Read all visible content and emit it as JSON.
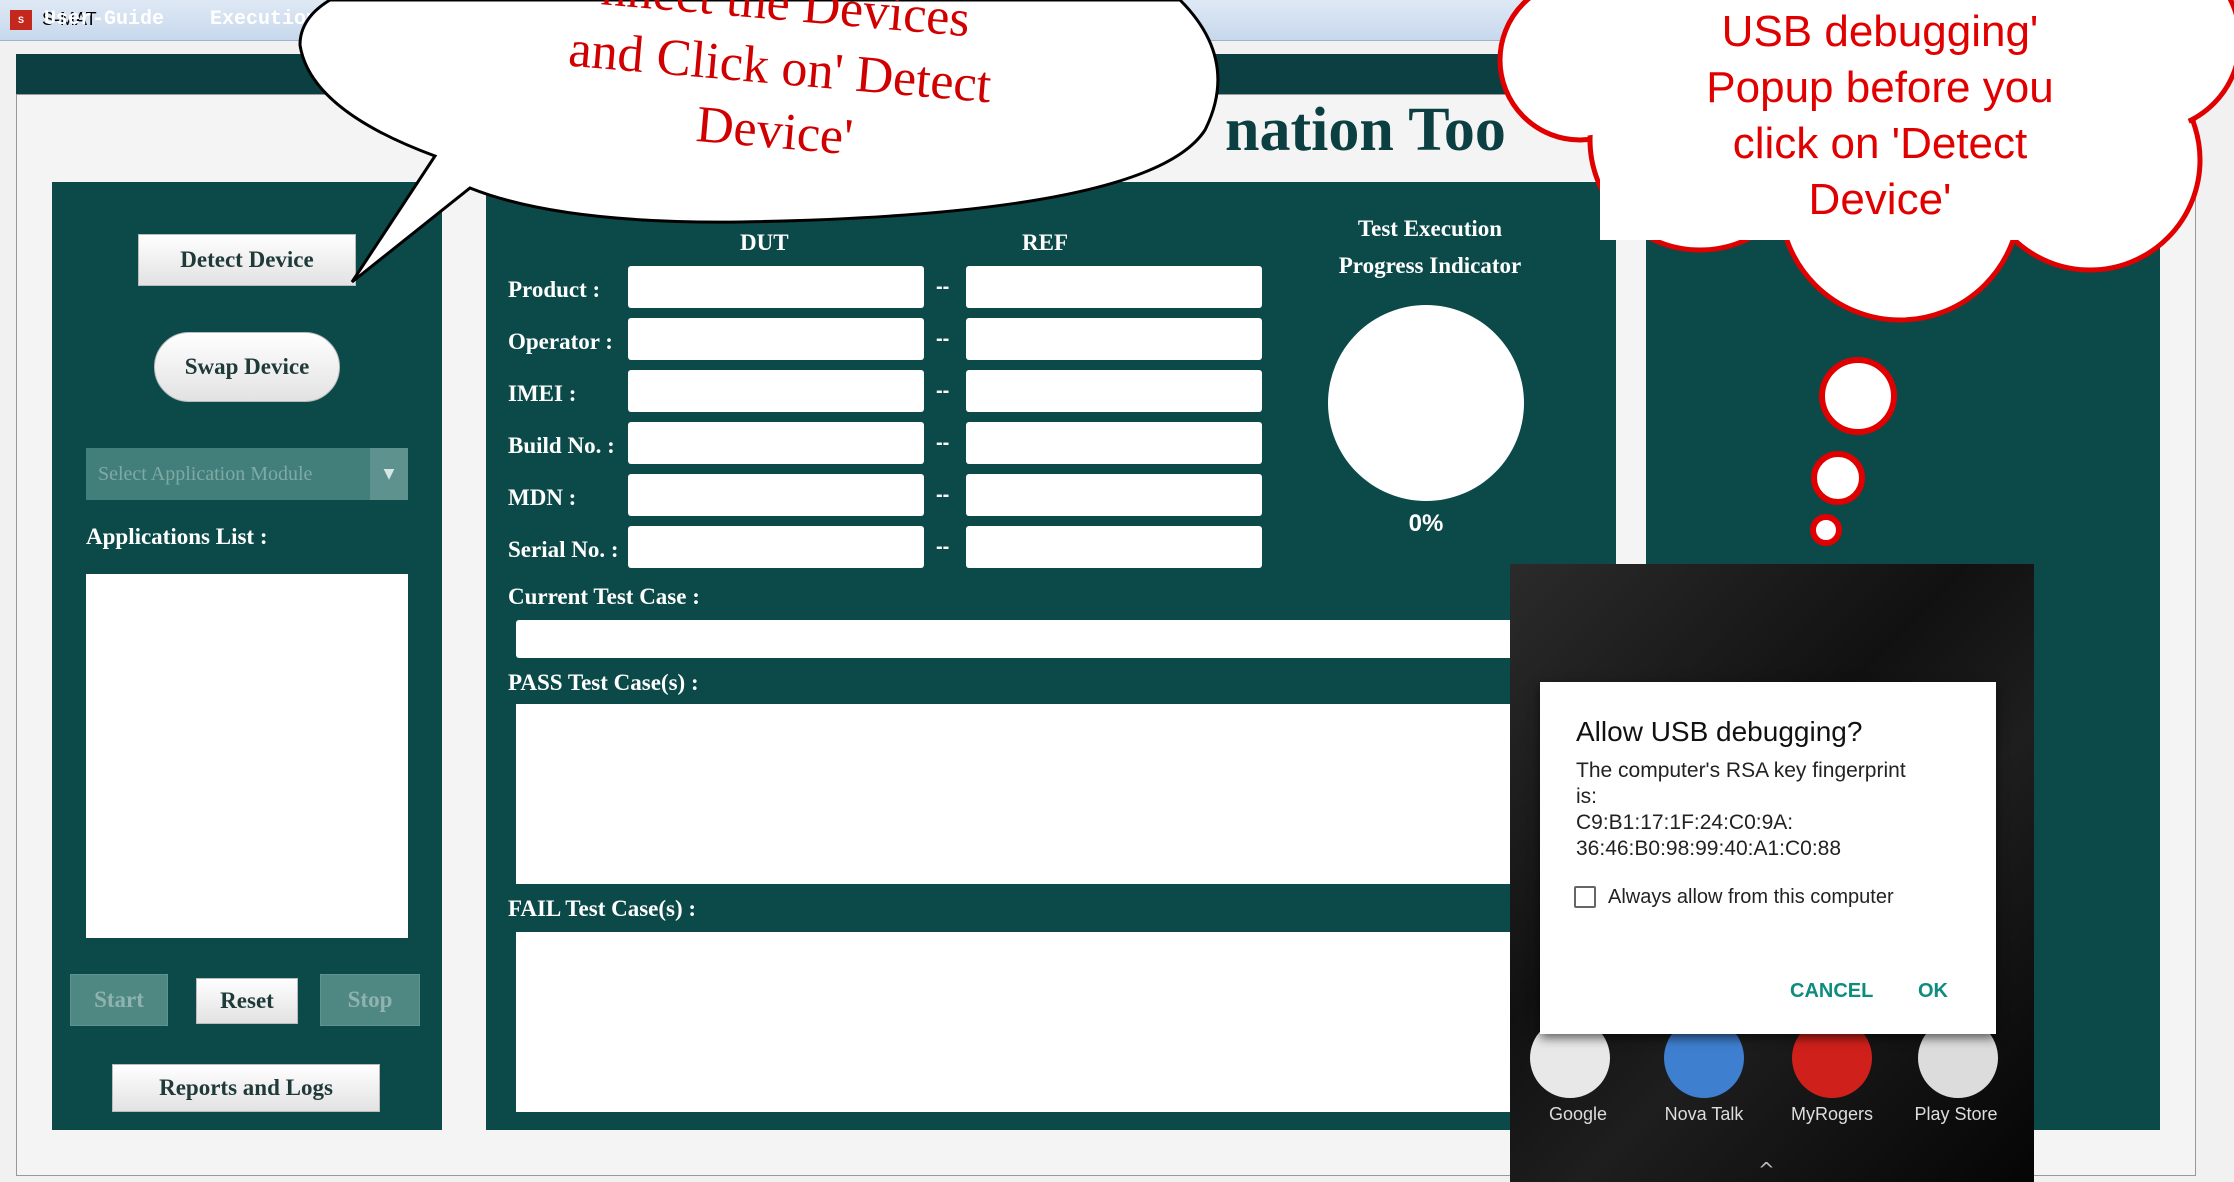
{
  "window": {
    "title": "S-MAT",
    "icon": "app-logo-icon"
  },
  "menu": [
    {
      "label": "User-Guide"
    },
    {
      "label": "Execution"
    }
  ],
  "app_heading": "nation Too",
  "left_panel": {
    "detect_button": "Detect Device",
    "swap_button": "Swap Device",
    "module_select_placeholder": "Select Application Module",
    "applications_label": "Applications List :",
    "start_button": "Start",
    "reset_button": "Reset",
    "stop_button": "Stop",
    "reports_button": "Reports and Logs"
  },
  "center_panel": {
    "col_dut": "DUT",
    "col_ref": "REF",
    "separator": "--",
    "fields": [
      {
        "label": "Product :",
        "dut": "",
        "ref": ""
      },
      {
        "label": "Operator :",
        "dut": "",
        "ref": ""
      },
      {
        "label": "IMEI :",
        "dut": "",
        "ref": ""
      },
      {
        "label": "Build No. :",
        "dut": "",
        "ref": ""
      },
      {
        "label": "MDN :",
        "dut": "",
        "ref": ""
      },
      {
        "label": "Serial No. :",
        "dut": "",
        "ref": ""
      }
    ],
    "progress_title_1": "Test Execution",
    "progress_title_2": "Progress Indicator",
    "progress_value": "0%",
    "progress_fraction": 0,
    "current_label": "Current Test Case :",
    "pass_label": "PASS Test Case(s) :",
    "fail_label": "FAIL Test Case(s) :"
  },
  "phone_dialog": {
    "title": "Allow USB debugging?",
    "body_1": "The computer's RSA key fingerprint",
    "body_2": "is:",
    "body_3": "C9:B1:17:1F:24:C0:9A:",
    "body_4": "36:46:B0:98:99:40:A1:C0:88",
    "checkbox_label": "Always allow from this computer",
    "cancel": "CANCEL",
    "ok": "OK"
  },
  "phone_apps": [
    {
      "label": "Google",
      "icon": "google-icon"
    },
    {
      "label": "Nova Talk",
      "icon": "nova-talk-icon"
    },
    {
      "label": "MyRogers",
      "icon": "myrogers-icon"
    },
    {
      "label": "Play Store",
      "icon": "play-store-icon"
    }
  ],
  "callout_left": {
    "line1": "nnect the Devices",
    "line2": "and Click on' Detect",
    "line3": "Device'"
  },
  "callout_right": {
    "line1": "USB debugging'",
    "line2": "Popup before you",
    "line3": "click on 'Detect",
    "line4": "Device'"
  },
  "colors": {
    "panel": "#0b4a49",
    "menu": "#0b3f42",
    "callout_text": "#e10000",
    "dialog_button": "#0e8c7f"
  }
}
